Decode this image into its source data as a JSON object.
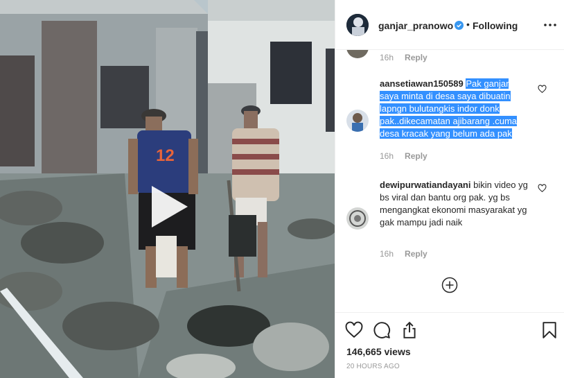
{
  "video": {
    "jersey_number": "12",
    "play_icon": "play-icon"
  },
  "header": {
    "username": "ganjar_pranowo",
    "verified_icon": "verified-badge-icon",
    "separator": "•",
    "follow_state": "Following",
    "more_icon": "more-options-icon"
  },
  "comments": [
    {
      "time": "16h",
      "reply_label": "Reply"
    },
    {
      "username": "aansetiawan150589",
      "text": "Pak ganjar saya minta di desa saya dibuatin lapngn bulutangkis indor donk pak..dikecamatan ajibarang .cuma desa kracak yang belum ada pak",
      "time": "16h",
      "reply_label": "Reply"
    },
    {
      "username": "dewipurwatiandayani",
      "text": "bikin video yg bs viral dan bantu org pak. yg bs mengangkat ekonomi masyarakat yg gak mampu jadi naik",
      "time": "16h",
      "reply_label": "Reply"
    }
  ],
  "load_more_icon": "plus-circle-icon",
  "actions": {
    "views": "146,665 views",
    "posted": "20 HOURS AGO"
  },
  "colors": {
    "text": "#262626",
    "muted": "#999999",
    "selection": "#3390ff",
    "border": "#efefef",
    "verified": "#3897f0"
  }
}
